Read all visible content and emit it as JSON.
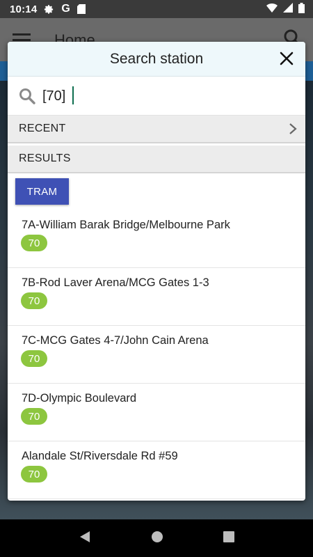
{
  "status_bar": {
    "time": "10:14",
    "left_icons": [
      "gear-icon",
      "google-icon",
      "sd-card-icon"
    ],
    "right_icons": [
      "wifi-icon",
      "signal-icon",
      "battery-icon"
    ]
  },
  "background_app": {
    "title": "Home"
  },
  "dialog": {
    "title": "Search station",
    "search": {
      "value": "[70]"
    },
    "recent_label": "RECENT",
    "results_label": "RESULTS",
    "filter_button": "TRAM",
    "results": [
      {
        "name": "7A-William Barak Bridge/Melbourne Park",
        "route": "70"
      },
      {
        "name": "7B-Rod Laver Arena/MCG Gates 1-3",
        "route": "70"
      },
      {
        "name": "7C-MCG Gates 4-7/John Cain Arena",
        "route": "70"
      },
      {
        "name": "7D-Olympic Boulevard",
        "route": "70"
      },
      {
        "name": "Alandale St/Riversdale Rd #59",
        "route": "70"
      }
    ]
  },
  "colors": {
    "accent": "#3f51b5",
    "route_badge": "#8dc63f",
    "header_bg": "#eef8fb"
  }
}
